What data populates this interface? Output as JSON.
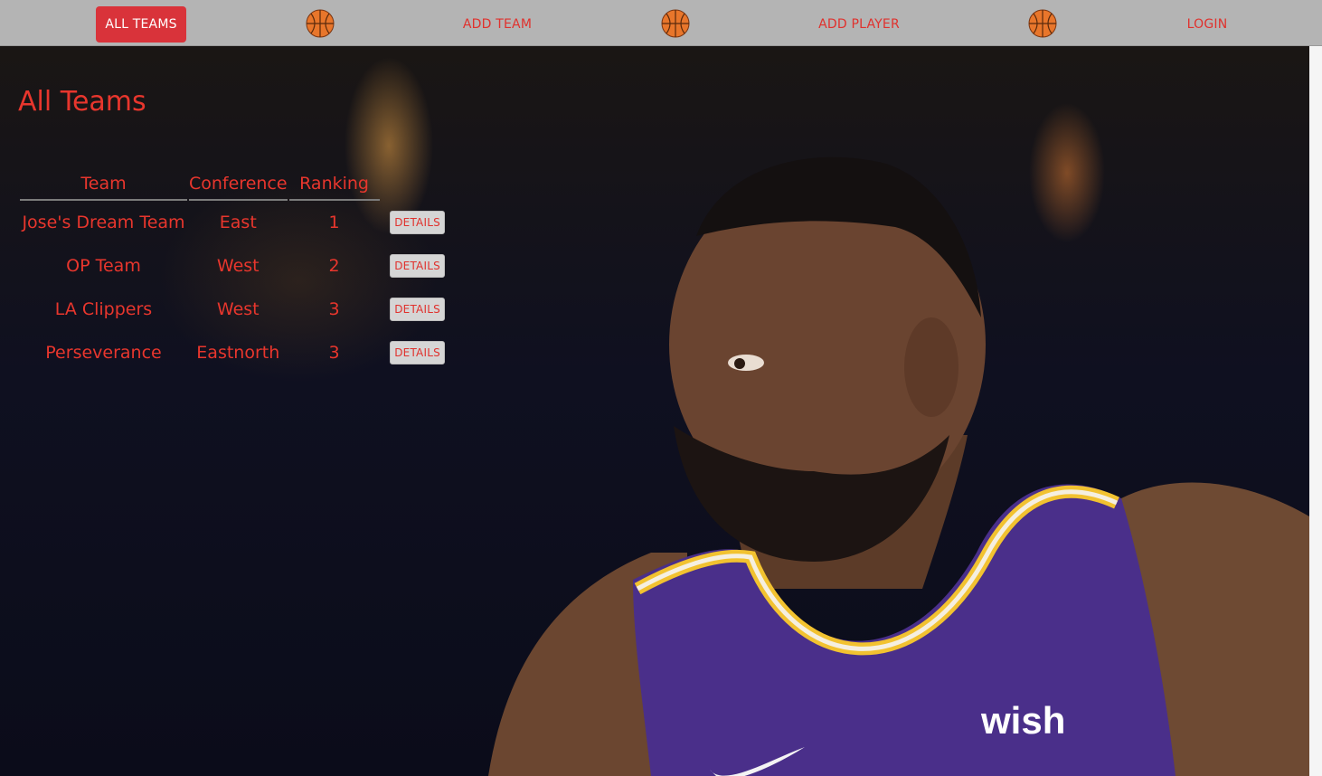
{
  "nav": {
    "items": [
      {
        "label": "ALL TEAMS",
        "active": true
      },
      {
        "label": "ADD TEAM",
        "active": false
      },
      {
        "label": "ADD PLAYER",
        "active": false
      },
      {
        "label": "LOGIN",
        "active": false
      }
    ],
    "icon": "basketball-icon"
  },
  "page": {
    "title": "All Teams"
  },
  "table": {
    "headers": [
      "Team",
      "Conference",
      "Ranking"
    ],
    "rows": [
      {
        "team": "Jose's Dream Team",
        "conference": "East",
        "ranking": "1",
        "action": "DETAILS"
      },
      {
        "team": "OP Team",
        "conference": "West",
        "ranking": "2",
        "action": "DETAILS"
      },
      {
        "team": "LA Clippers",
        "conference": "West",
        "ranking": "3",
        "action": "DETAILS"
      },
      {
        "team": "Perseverance",
        "conference": "Eastnorth",
        "ranking": "3",
        "action": "DETAILS"
      }
    ]
  },
  "colors": {
    "accent": "#e8362d",
    "nav_bg": "#b4b4b4",
    "active_bg": "#d9333a",
    "button_bg": "#d5d5d5"
  }
}
